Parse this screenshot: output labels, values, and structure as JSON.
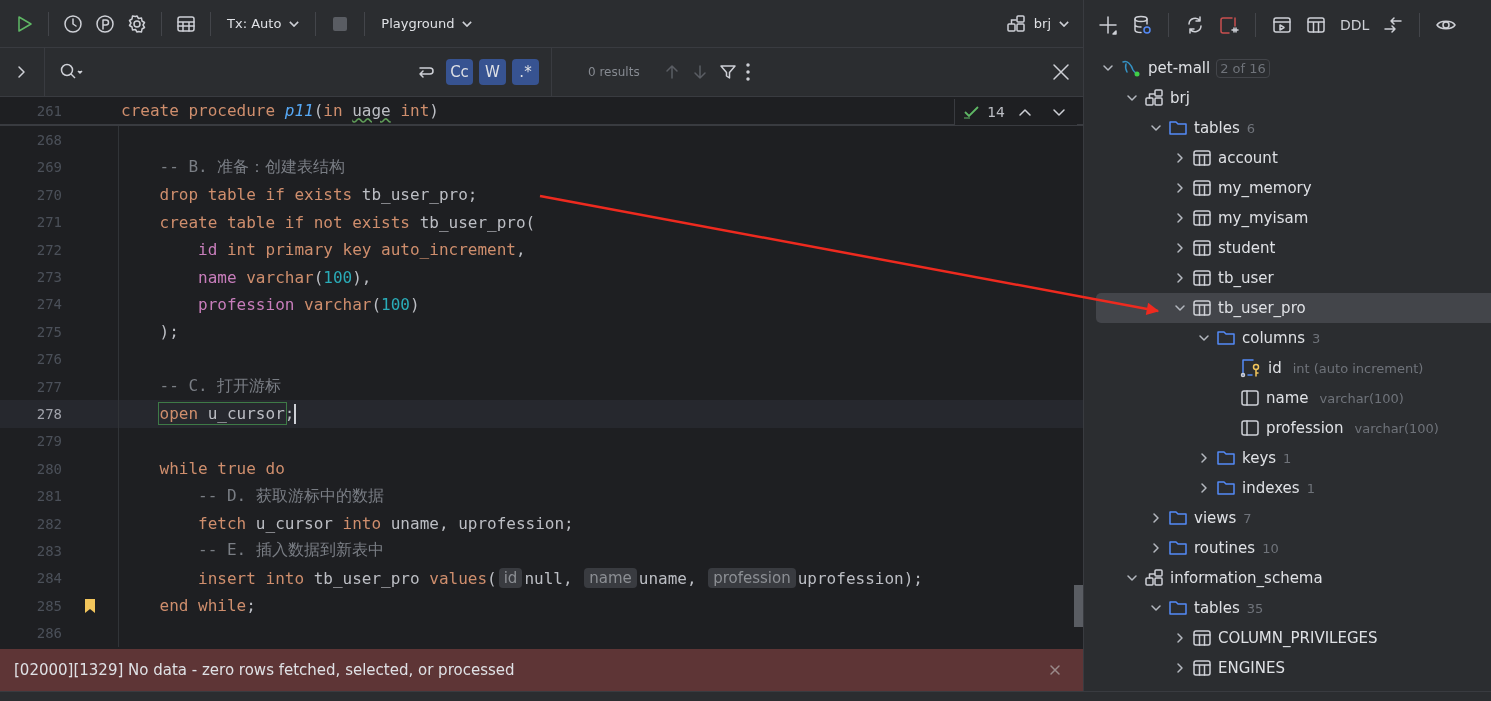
{
  "toolbar": {
    "tx_mode": "Tx: Auto",
    "console": "Playground",
    "schema": "brj"
  },
  "search": {
    "results": "0 results",
    "toggles": [
      {
        "label": "Cc",
        "selected": true
      },
      {
        "label": "W",
        "selected": true
      },
      {
        "label": ".*",
        "selected": true
      }
    ]
  },
  "inspection": {
    "count": "14"
  },
  "editor": {
    "lines": [
      {
        "number": "261",
        "sticky": true,
        "current": false,
        "bookmarked": false,
        "segments": [
          {
            "kind": "code",
            "tokens": [
              {
                "t": "create procedure ",
                "kind": "kw"
              },
              {
                "t": "p11",
                "kind": "fn"
              },
              {
                "t": "(",
                "kind": "plain"
              },
              {
                "t": "in ",
                "kind": "kw"
              },
              {
                "t": "uage",
                "kind": "warn"
              },
              {
                "t": " int",
                "kind": "kw"
              },
              {
                "t": ")",
                "kind": "plain"
              }
            ]
          }
        ]
      },
      {
        "number": "268",
        "sticky": false,
        "current": false,
        "bookmarked": false
      },
      {
        "number": "269",
        "sticky": false,
        "current": false,
        "bookmarked": false,
        "segments": [
          {
            "kind": "code",
            "tokens": [
              {
                "t": "    -- B. 准备：创建表结构",
                "kind": "comment"
              }
            ]
          }
        ]
      },
      {
        "number": "270",
        "sticky": false,
        "current": false,
        "bookmarked": false,
        "segments": [
          {
            "kind": "code",
            "tokens": [
              {
                "t": "    drop table if exists ",
                "kind": "kw"
              },
              {
                "t": "tb_user_pro;",
                "kind": "plain"
              }
            ]
          }
        ]
      },
      {
        "number": "271",
        "sticky": false,
        "current": false,
        "bookmarked": false,
        "segments": [
          {
            "kind": "code",
            "tokens": [
              {
                "t": "    create table if not exists ",
                "kind": "kw"
              },
              {
                "t": "tb_user_pro(",
                "kind": "plain"
              }
            ]
          }
        ]
      },
      {
        "number": "272",
        "sticky": false,
        "current": false,
        "bookmarked": false,
        "segments": [
          {
            "kind": "code",
            "tokens": [
              {
                "t": "        id",
                "kind": "col"
              },
              {
                "t": " int primary key auto_increment",
                "kind": "kw"
              },
              {
                "t": ",",
                "kind": "plain"
              }
            ]
          }
        ]
      },
      {
        "number": "273",
        "sticky": false,
        "current": false,
        "bookmarked": false,
        "segments": [
          {
            "kind": "code",
            "tokens": [
              {
                "t": "        name",
                "kind": "col"
              },
              {
                "t": " varchar",
                "kind": "kw"
              },
              {
                "t": "(",
                "kind": "plain"
              },
              {
                "t": "100",
                "kind": "num"
              },
              {
                "t": "),",
                "kind": "plain"
              }
            ]
          }
        ]
      },
      {
        "number": "274",
        "sticky": false,
        "current": false,
        "bookmarked": false,
        "segments": [
          {
            "kind": "code",
            "tokens": [
              {
                "t": "        profession",
                "kind": "col"
              },
              {
                "t": " varchar",
                "kind": "kw"
              },
              {
                "t": "(",
                "kind": "plain"
              },
              {
                "t": "100",
                "kind": "num"
              },
              {
                "t": ")",
                "kind": "plain"
              }
            ]
          }
        ]
      },
      {
        "number": "275",
        "sticky": false,
        "current": false,
        "bookmarked": false,
        "segments": [
          {
            "kind": "code",
            "tokens": [
              {
                "t": "    );",
                "kind": "plain"
              }
            ]
          }
        ]
      },
      {
        "number": "276",
        "sticky": false,
        "current": false,
        "bookmarked": false
      },
      {
        "number": "277",
        "sticky": false,
        "current": false,
        "bookmarked": false,
        "segments": [
          {
            "kind": "code",
            "tokens": [
              {
                "t": "    -- C. 打开游标",
                "kind": "comment"
              }
            ]
          }
        ]
      },
      {
        "number": "278",
        "sticky": false,
        "current": true,
        "bookmarked": false,
        "segments": [
          {
            "kind": "highlight",
            "tokens": [
              {
                "t": "    open",
                "kind": "kw"
              },
              {
                "t": " u_cursor",
                "kind": "plain"
              }
            ]
          },
          {
            "kind": "code",
            "tokens": [
              {
                "t": ";",
                "kind": "plain"
              }
            ]
          }
        ]
      },
      {
        "number": "279",
        "sticky": false,
        "current": false,
        "bookmarked": false
      },
      {
        "number": "280",
        "sticky": false,
        "current": false,
        "bookmarked": false,
        "segments": [
          {
            "kind": "code",
            "tokens": [
              {
                "t": "    while true do",
                "kind": "kw"
              }
            ]
          }
        ]
      },
      {
        "number": "281",
        "sticky": false,
        "current": false,
        "bookmarked": false,
        "segments": [
          {
            "kind": "code",
            "tokens": [
              {
                "t": "        -- D. 获取游标中的数据",
                "kind": "comment"
              }
            ]
          }
        ]
      },
      {
        "number": "282",
        "sticky": false,
        "current": false,
        "bookmarked": false,
        "segments": [
          {
            "kind": "code",
            "tokens": [
              {
                "t": "        fetch",
                "kind": "kw"
              },
              {
                "t": " u_cursor ",
                "kind": "plain"
              },
              {
                "t": "into",
                "kind": "kw"
              },
              {
                "t": " uname, uprofession;",
                "kind": "plain"
              }
            ]
          }
        ]
      },
      {
        "number": "283",
        "sticky": false,
        "current": false,
        "bookmarked": false,
        "segments": [
          {
            "kind": "code",
            "tokens": [
              {
                "t": "        -- E. 插入数据到新表中",
                "kind": "comment"
              }
            ]
          }
        ]
      },
      {
        "number": "284",
        "sticky": false,
        "current": false,
        "bookmarked": false,
        "segments": [
          {
            "kind": "code",
            "tokens": [
              {
                "t": "        insert into",
                "kind": "kw"
              },
              {
                "t": " tb_user_pro ",
                "kind": "plain"
              },
              {
                "t": "values",
                "kind": "kw"
              },
              {
                "t": "(",
                "kind": "plain"
              }
            ]
          },
          {
            "kind": "hint",
            "text": "id"
          },
          {
            "kind": "code",
            "tokens": [
              {
                "t": "null, ",
                "kind": "plain"
              }
            ]
          },
          {
            "kind": "hint",
            "text": "name"
          },
          {
            "kind": "code",
            "tokens": [
              {
                "t": "uname, ",
                "kind": "plain"
              }
            ]
          },
          {
            "kind": "hint",
            "text": "profession"
          },
          {
            "kind": "code",
            "tokens": [
              {
                "t": "uprofession);",
                "kind": "plain"
              }
            ]
          }
        ]
      },
      {
        "number": "285",
        "sticky": false,
        "current": false,
        "bookmarked": true,
        "segments": [
          {
            "kind": "code",
            "tokens": [
              {
                "t": "    end while",
                "kind": "kw"
              },
              {
                "t": ";",
                "kind": "plain"
              }
            ]
          }
        ]
      },
      {
        "number": "286",
        "sticky": false,
        "current": false,
        "bookmarked": false
      }
    ]
  },
  "error": {
    "message": "[02000][1329] No data - zero rows fetched, selected, or processed"
  },
  "explorer": {
    "toolbar": {
      "ddl": "DDL"
    },
    "tree": [
      {
        "label": "pet-mall",
        "kind": "connection",
        "badge": "2 of 16",
        "expanded": true,
        "selected": false,
        "children": [
          {
            "label": "brj",
            "kind": "schema",
            "expanded": true,
            "selected": false,
            "children": [
              {
                "label": "tables",
                "kind": "folder",
                "count": "6",
                "expanded": true,
                "selected": false,
                "children": [
                  {
                    "label": "account",
                    "kind": "table",
                    "expanded": false,
                    "selected": false
                  },
                  {
                    "label": "my_memory",
                    "kind": "table",
                    "expanded": false,
                    "selected": false
                  },
                  {
                    "label": "my_myisam",
                    "kind": "table",
                    "expanded": false,
                    "selected": false
                  },
                  {
                    "label": "student",
                    "kind": "table",
                    "expanded": false,
                    "selected": false
                  },
                  {
                    "label": "tb_user",
                    "kind": "table",
                    "expanded": false,
                    "selected": false
                  },
                  {
                    "label": "tb_user_pro",
                    "kind": "table",
                    "expanded": true,
                    "selected": true,
                    "children": [
                      {
                        "label": "columns",
                        "kind": "folder",
                        "count": "3",
                        "expanded": true,
                        "selected": false,
                        "children": [
                          {
                            "label": "id",
                            "kind": "key-column",
                            "detail": "int (auto increment)",
                            "selected": false
                          },
                          {
                            "label": "name",
                            "kind": "column",
                            "detail": "varchar(100)",
                            "selected": false
                          },
                          {
                            "label": "profession",
                            "kind": "column",
                            "detail": "varchar(100)",
                            "selected": false
                          }
                        ]
                      },
                      {
                        "label": "keys",
                        "kind": "folder",
                        "count": "1",
                        "expanded": false,
                        "selected": false
                      },
                      {
                        "label": "indexes",
                        "kind": "folder",
                        "count": "1",
                        "expanded": false,
                        "selected": false
                      }
                    ]
                  }
                ]
              },
              {
                "label": "views",
                "kind": "folder",
                "count": "7",
                "expanded": false,
                "selected": false
              },
              {
                "label": "routines",
                "kind": "folder",
                "count": "10",
                "expanded": false,
                "selected": false
              }
            ]
          },
          {
            "label": "information_schema",
            "kind": "schema",
            "expanded": true,
            "selected": false,
            "children": [
              {
                "label": "tables",
                "kind": "folder",
                "count": "35",
                "expanded": true,
                "selected": false,
                "children": [
                  {
                    "label": "COLUMN_PRIVILEGES",
                    "kind": "table",
                    "expanded": false,
                    "selected": false
                  },
                  {
                    "label": "ENGINES",
                    "kind": "table",
                    "expanded": false,
                    "selected": false
                  }
                ]
              }
            ]
          }
        ]
      }
    ]
  }
}
